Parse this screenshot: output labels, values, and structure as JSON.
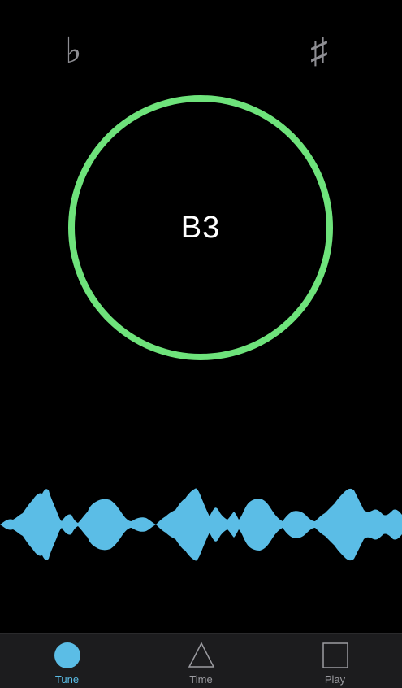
{
  "accidentals": {
    "flat": "♭",
    "sharp": "♯"
  },
  "tuner": {
    "note": "B3",
    "ring_color": "#6ee37b"
  },
  "waveform": {
    "color": "#5bbde6"
  },
  "tabs": [
    {
      "label": "Tune",
      "icon": "circle-icon",
      "active": true
    },
    {
      "label": "Time",
      "icon": "triangle-icon",
      "active": false
    },
    {
      "label": "Play",
      "icon": "square-icon",
      "active": false
    }
  ],
  "colors": {
    "accent": "#5bbde6",
    "inactive": "#9b9ba0",
    "tabbar_bg": "#1c1c1e"
  }
}
